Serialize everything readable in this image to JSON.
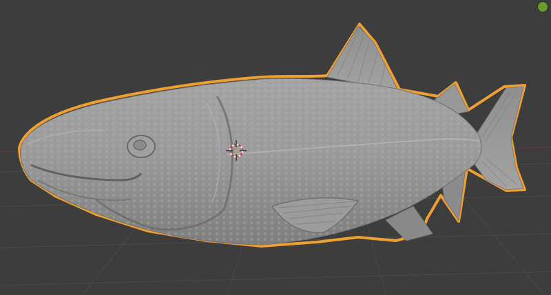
{
  "viewport": {
    "background_color": "#3d3d3d",
    "grid_color": "#4a4a4a",
    "object": {
      "name": "salmon-sculpt-mesh",
      "state": "selected",
      "mesh_color": "#9a9a9a",
      "selection_outline_color": "#f0a030"
    },
    "cursor_3d": {
      "icon": "3d-cursor-icon",
      "ring_color_a": "#ffffff",
      "ring_color_b": "#d0303a"
    },
    "gizmo": {
      "icon": "navigation-gizmo-icon",
      "color": "#6c9a2b"
    }
  }
}
